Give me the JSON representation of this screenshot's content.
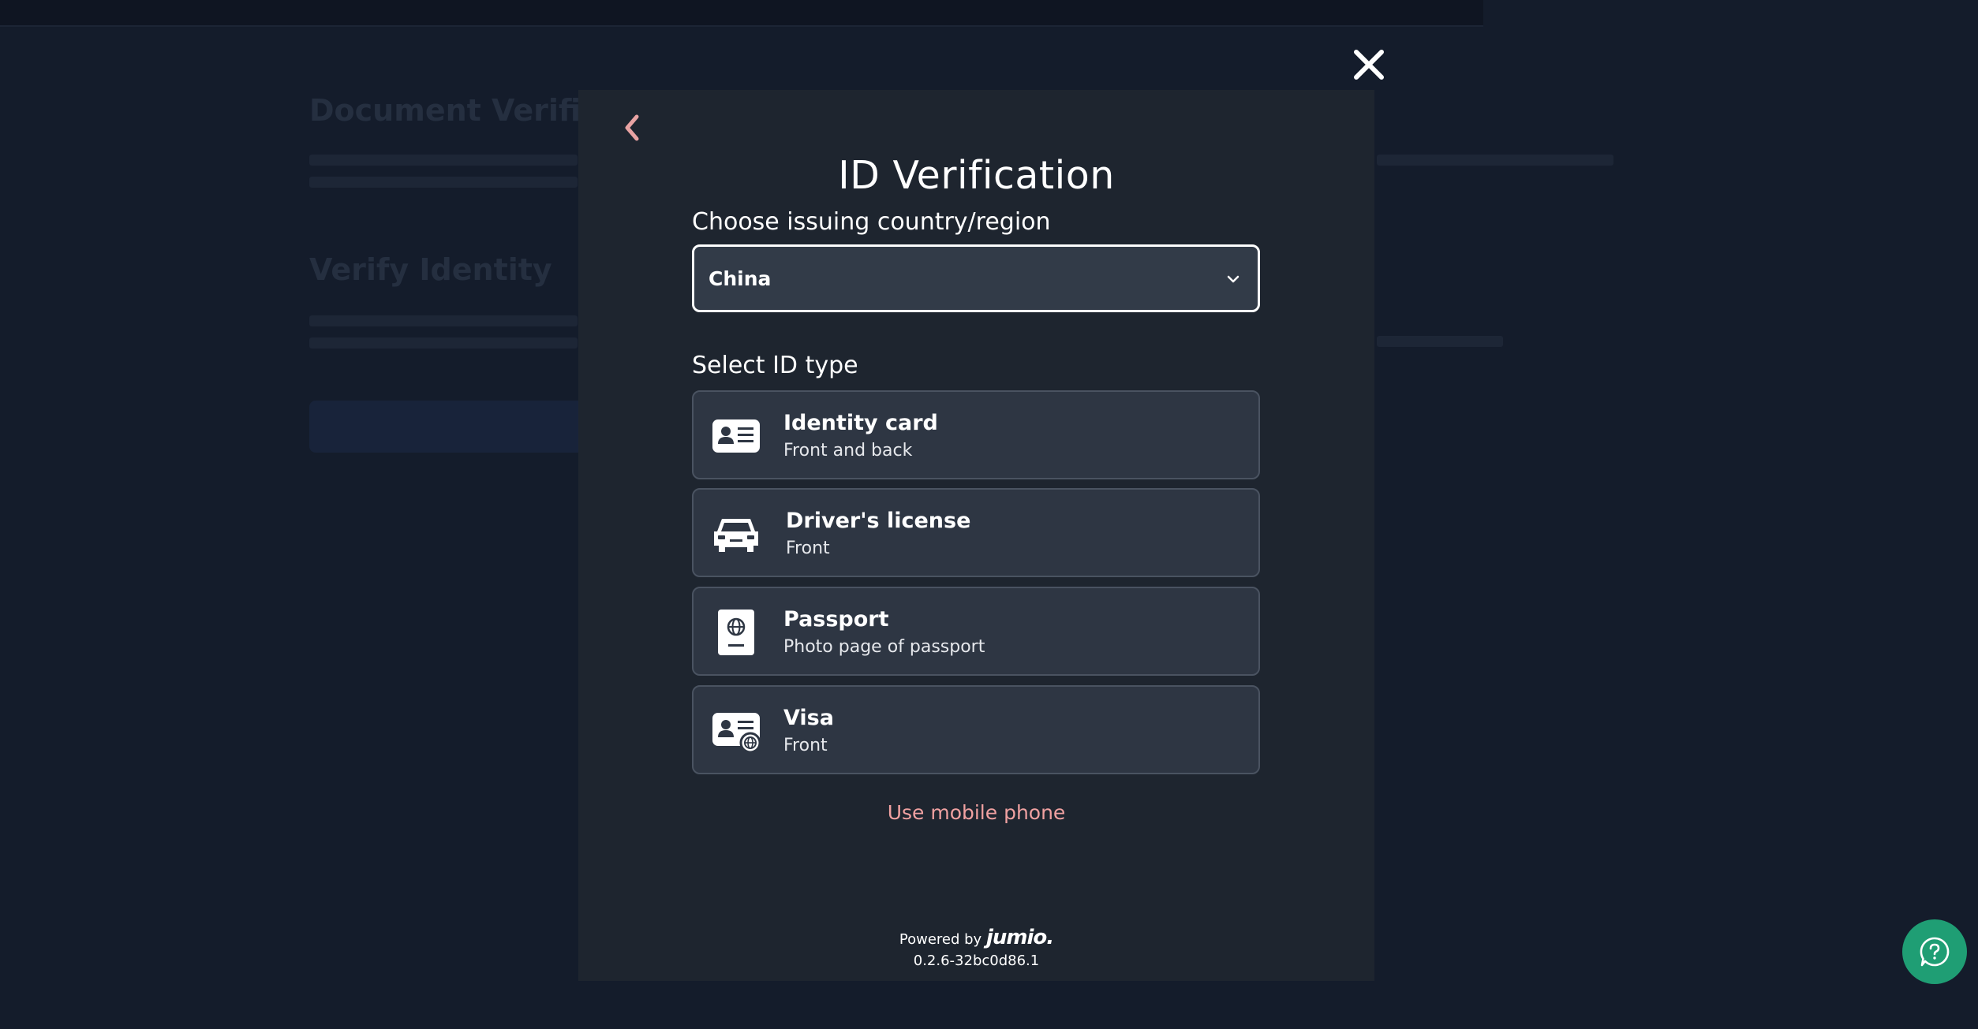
{
  "modal": {
    "title": "ID Verification",
    "country_label": "Choose issuing country/region",
    "country_value": "China",
    "idtype_label": "Select ID type",
    "options": [
      {
        "title": "Identity card",
        "subtitle": "Front and back",
        "icon": "identity-card-icon"
      },
      {
        "title": "Driver's license",
        "subtitle": "Front",
        "icon": "car-icon"
      },
      {
        "title": "Passport",
        "subtitle": "Photo page of passport",
        "icon": "passport-icon"
      },
      {
        "title": "Visa",
        "subtitle": "Front",
        "icon": "visa-icon"
      }
    ],
    "mobile_link": "Use mobile phone",
    "powered_by": "Powered by",
    "brand": "jumio.",
    "version": "0.2.6-32bc0d86.1"
  },
  "background_page": {
    "title": "Document Verificat",
    "section_title": "Verify Identity"
  },
  "colors": {
    "modal_bg": "#1e252f",
    "option_bg": "#2e3643",
    "link": "#f0a1a1",
    "help_button": "#1f9e74",
    "back_chevron": "#e8a3a3"
  },
  "icons": {
    "close": "close-icon",
    "back": "chevron-left-icon",
    "dropdown": "chevron-down-icon",
    "help": "question-circle-icon"
  }
}
